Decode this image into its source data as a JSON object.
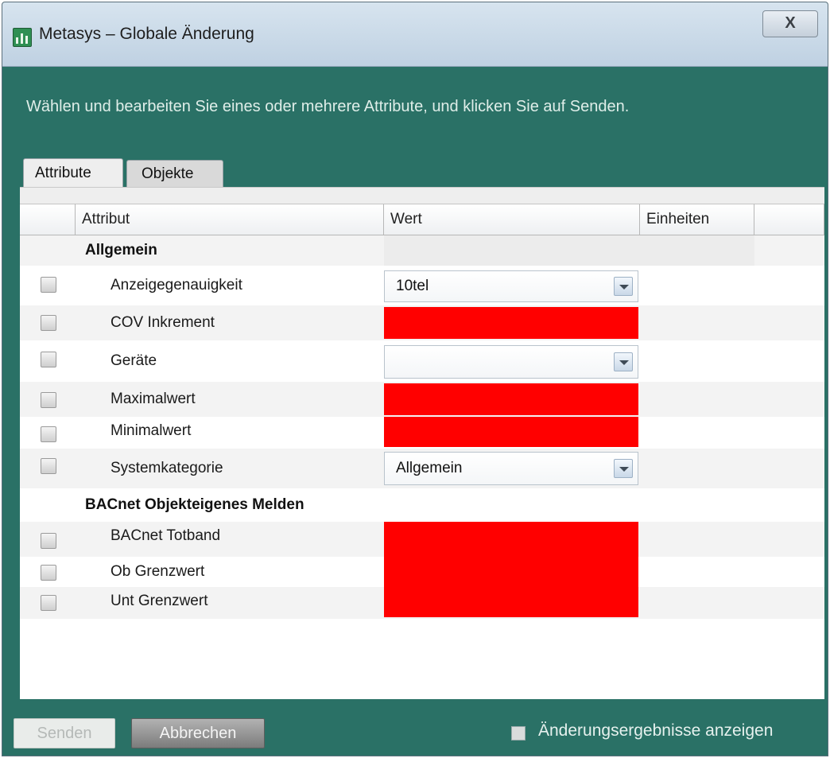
{
  "window": {
    "title": "Metasys – Globale Änderung",
    "close_label": "X"
  },
  "instructions": "Wählen und bearbeiten Sie eines oder mehrere Attribute, und klicken Sie auf Senden.",
  "tabs": [
    {
      "label": "Attribute",
      "active": true
    },
    {
      "label": "Objekte",
      "active": false
    }
  ],
  "table": {
    "columns": [
      "Attribut",
      "Wert",
      "Einheiten"
    ],
    "groups": [
      {
        "label": "Allgemein",
        "rows": [
          {
            "name": "Anzeigegenauigkeit",
            "type": "combo",
            "value": "10tel"
          },
          {
            "name": "COV Inkrement",
            "type": "red",
            "value": ""
          },
          {
            "name": "Geräte",
            "type": "combo",
            "value": ""
          },
          {
            "name": "Maximalwert",
            "type": "red",
            "value": ""
          },
          {
            "name": "Minimalwert",
            "type": "red",
            "value": ""
          },
          {
            "name": "Systemkategorie",
            "type": "combo",
            "value": "Allgemein"
          }
        ]
      },
      {
        "label": "BACnet Objekteigenes Melden",
        "rows": [
          {
            "name": "BACnet Totband",
            "type": "red",
            "value": ""
          },
          {
            "name": "Ob Grenzwert",
            "type": "red",
            "value": ""
          },
          {
            "name": "Unt Grenzwert",
            "type": "red",
            "value": ""
          }
        ]
      }
    ]
  },
  "footer": {
    "send_label": "Senden",
    "cancel_label": "Abbrechen",
    "show_results_label": "Änderungsergebnisse anzeigen"
  },
  "colors": {
    "accent": "#2a7166",
    "invalid_value": "#ff0000"
  }
}
